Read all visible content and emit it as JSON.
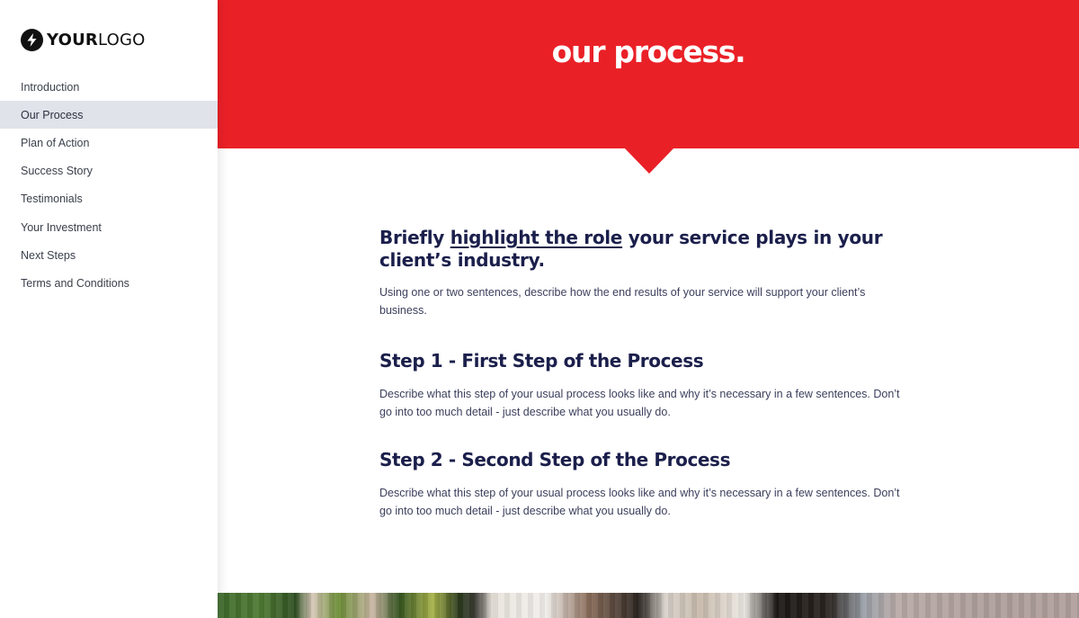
{
  "logo": {
    "icon": "lightning-bolt-icon",
    "text_bold": "YOUR",
    "text_light": "LOGO"
  },
  "sidebar": {
    "active_index": 1,
    "items": [
      {
        "label": "Introduction"
      },
      {
        "label": "Our Process"
      },
      {
        "label": "Plan of Action"
      },
      {
        "label": "Success Story"
      },
      {
        "label": "Testimonials"
      },
      {
        "label": "Your Investment"
      },
      {
        "label": "Next Steps"
      },
      {
        "label": "Terms and Conditions"
      }
    ]
  },
  "banner": {
    "title": "our process.",
    "color": "#ea2027"
  },
  "content": {
    "lead": {
      "prefix": "Briefly ",
      "highlight": "highlight the role",
      "suffix": " your service plays in your client’s industry."
    },
    "lead_paragraph": "Using one or two sentences, describe how the end results of your service will support your client’s business.",
    "steps": [
      {
        "number_label": "Step 1 - ",
        "title": "First Step of the Process",
        "description": "Describe what this step of your usual process looks like and why it’s necessary in a few sentences. Don’t go into too much detail - just describe what you usually do."
      },
      {
        "number_label": "Step 2 - ",
        "title": "Second Step of the Process",
        "description": "Describe what this step of your usual process looks like and why it’s necessary in a few sentences. Don’t go into too much detail - just describe what you usually do."
      }
    ]
  },
  "colors": {
    "accent": "#ea2027",
    "heading": "#1b1f4b",
    "body_text": "#3b3f5c",
    "nav_active_bg": "#e1e3ea"
  },
  "photo": {
    "description": "office plants and interior photo strip"
  }
}
